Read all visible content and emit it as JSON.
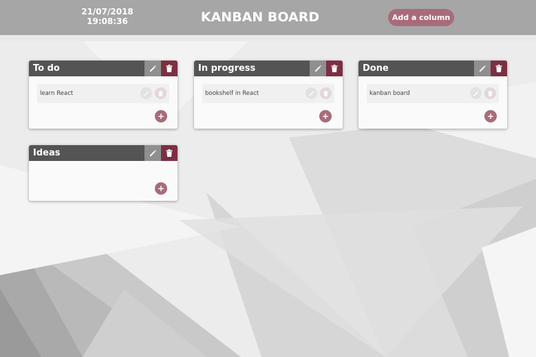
{
  "header": {
    "date": "21/07/2018",
    "time": "19:08:36",
    "title": "KANBAN BOARD",
    "add_column_label": "Add a column"
  },
  "icons": {
    "column_edit": "pencil-icon",
    "column_delete": "trash-icon",
    "card_edit": "pencil-icon",
    "card_delete": "trash-icon",
    "add_card": "+"
  },
  "colors": {
    "header_bg": "#a6a6a6",
    "column_header_bg": "#545454",
    "edit_button_bg": "#8f8f8f",
    "delete_button_bg": "#7b3042",
    "accent": "#a86b7a"
  },
  "columns": [
    {
      "title": "To do",
      "cards": [
        {
          "text": "learn React"
        }
      ]
    },
    {
      "title": "In progress",
      "cards": [
        {
          "text": "bookshelf in React"
        }
      ]
    },
    {
      "title": "Done",
      "cards": [
        {
          "text": "kanban board"
        }
      ]
    },
    {
      "title": "Ideas",
      "cards": []
    }
  ]
}
